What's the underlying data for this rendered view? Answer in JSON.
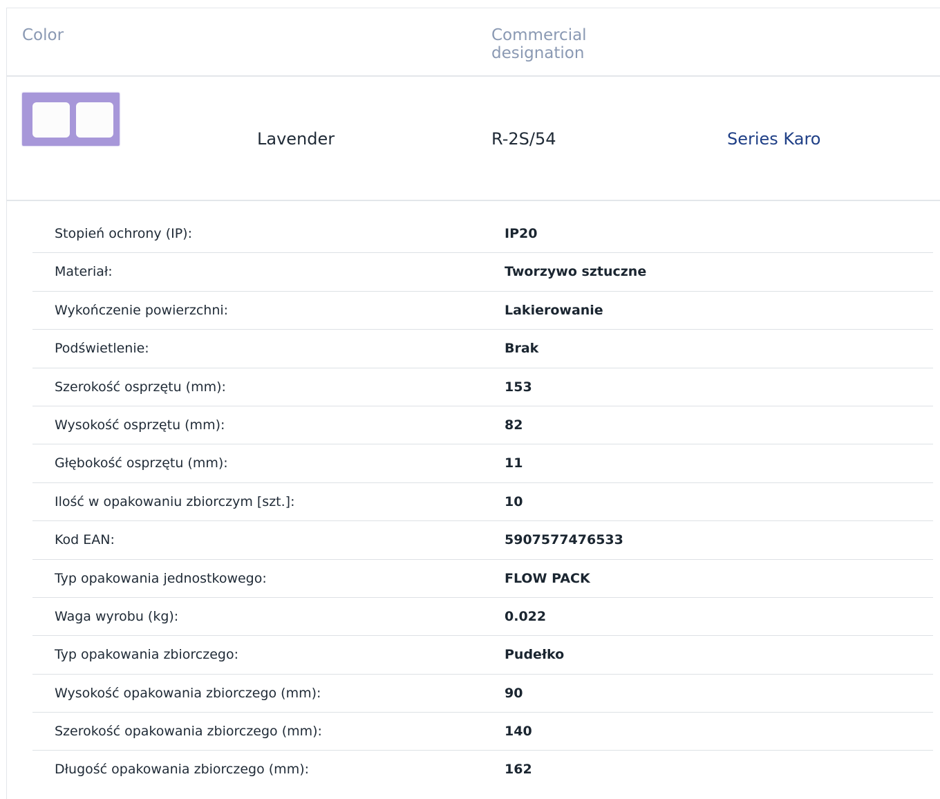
{
  "header": {
    "color_label": "Color",
    "designation_label": "Commercial designation"
  },
  "product": {
    "swatch_color": "#a797d9",
    "color_name": "Lavender",
    "designation": "R-2S/54",
    "series_link": "Series Karo"
  },
  "specs": [
    {
      "label": "Stopień ochrony (IP):",
      "value": "IP20"
    },
    {
      "label": "Materiał:",
      "value": "Tworzywo sztuczne"
    },
    {
      "label": "Wykończenie powierzchni:",
      "value": "Lakierowanie"
    },
    {
      "label": "Podświetlenie:",
      "value": "Brak"
    },
    {
      "label": "Szerokość osprzętu (mm):",
      "value": "153"
    },
    {
      "label": "Wysokość osprzętu (mm):",
      "value": "82"
    },
    {
      "label": "Głębokość osprzętu (mm):",
      "value": "11"
    },
    {
      "label": "Ilość w opakowaniu zbiorczym [szt.]:",
      "value": "10"
    },
    {
      "label": "Kod EAN:",
      "value": "5907577476533"
    },
    {
      "label": "Typ opakowania jednostkowego:",
      "value": "FLOW PACK"
    },
    {
      "label": "Waga wyrobu (kg):",
      "value": "0.022"
    },
    {
      "label": "Typ opakowania zbiorczego:",
      "value": "Pudełko"
    },
    {
      "label": "Wysokość opakowania zbiorczego (mm):",
      "value": "90"
    },
    {
      "label": "Szerokość opakowania zbiorczego (mm):",
      "value": "140"
    },
    {
      "label": "Długość opakowania zbiorczego (mm):",
      "value": "162"
    }
  ]
}
